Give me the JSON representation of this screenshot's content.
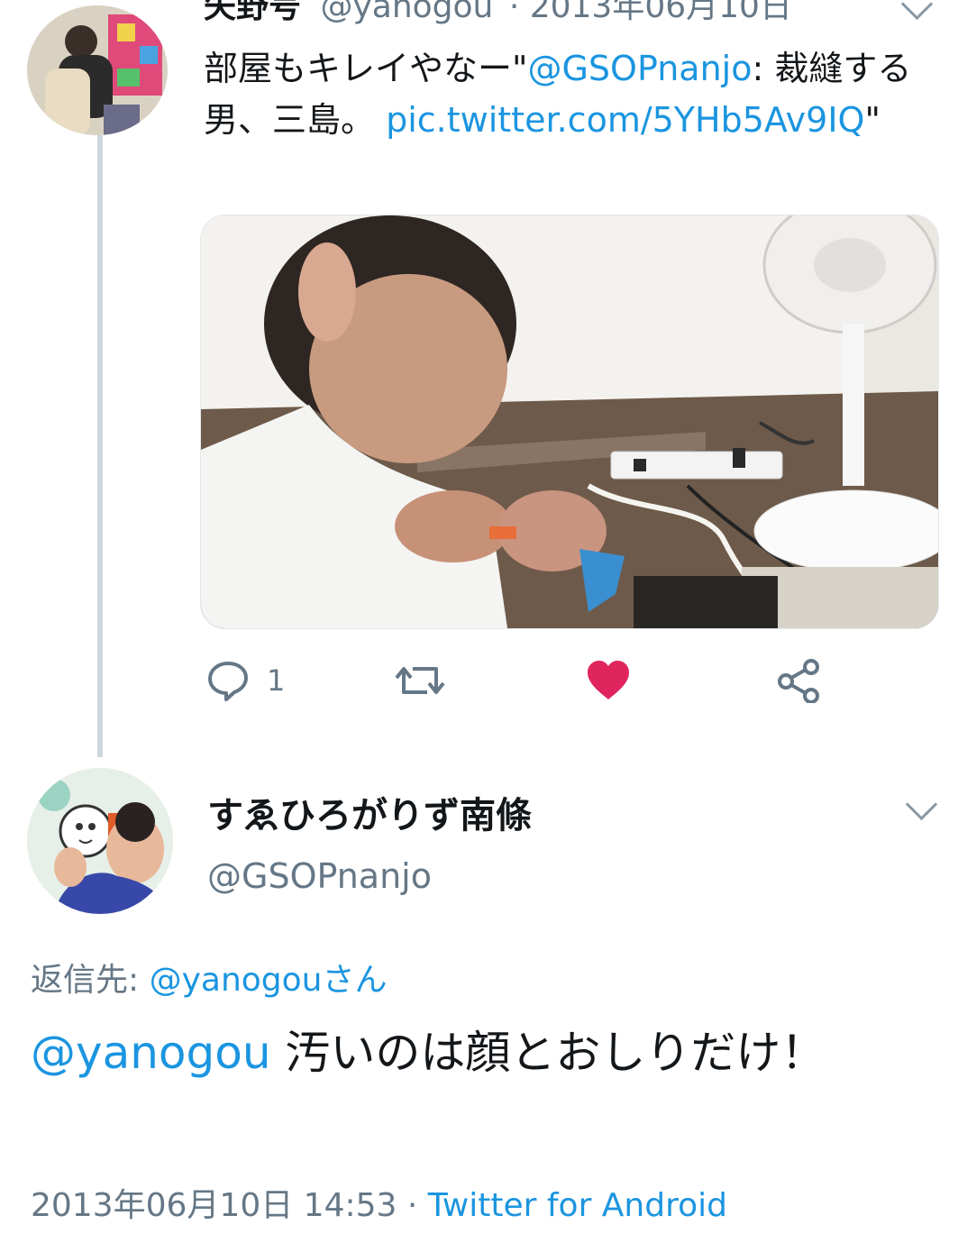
{
  "parent_tweet": {
    "author_name_partial": "矢野号",
    "handle": "@yanogou",
    "date_partial": "· 2013年06月10日",
    "text_prefix": "部屋もキレイやなー\"",
    "mention": "@GSOPnanjo",
    "text_middle": ": 裁縫する男、三島。 ",
    "link_text": "pic.twitter.com/5YHb5Av9IQ",
    "text_suffix": "\"",
    "actions": {
      "reply_icon": "reply-bubble-icon",
      "reply_count": "1",
      "retweet_icon": "retweet-icon",
      "like_icon": "heart-icon",
      "like_color": "#e0245e",
      "share_icon": "share-icon"
    }
  },
  "reply_tweet": {
    "display_name": "すゑひろがりず南條",
    "handle": "@GSOPnanjo",
    "reply_to_label": "返信先: ",
    "reply_to_user": "@yanogouさん",
    "mention": "@yanogou",
    "text": " 汚いのは顔とおしりだけ！",
    "timestamp": "2013年06月10日 14:53 · ",
    "client": "Twitter for Android"
  },
  "colors": {
    "link": "#1b95e0",
    "secondary_text": "#657786",
    "thread_line": "#ccd6dd"
  }
}
